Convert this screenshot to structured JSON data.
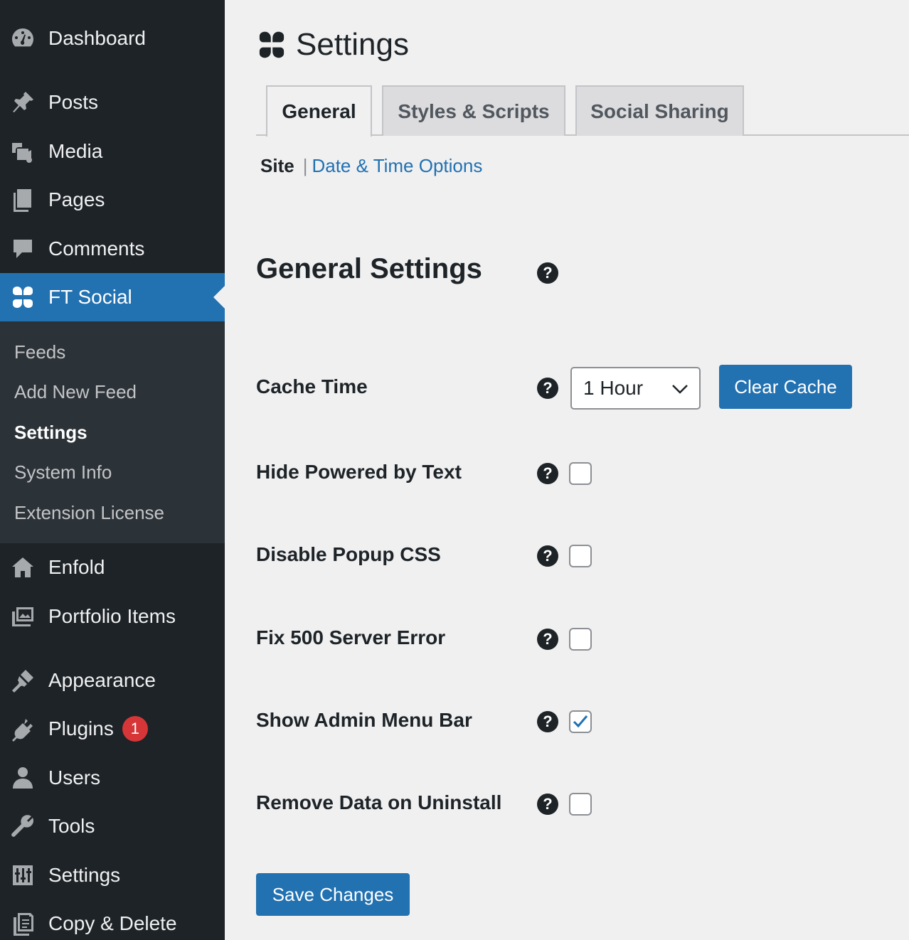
{
  "sidebar": {
    "items": [
      {
        "label": "Dashboard",
        "icon": "dashboard-icon"
      },
      {
        "label": "Posts",
        "icon": "pin-icon"
      },
      {
        "label": "Media",
        "icon": "media-icon"
      },
      {
        "label": "Pages",
        "icon": "pages-icon"
      },
      {
        "label": "Comments",
        "icon": "comment-icon"
      },
      {
        "label": "FT Social",
        "icon": "ft-social-icon"
      },
      {
        "label": "Enfold",
        "icon": "home-icon"
      },
      {
        "label": "Portfolio Items",
        "icon": "portfolio-icon"
      },
      {
        "label": "Appearance",
        "icon": "brush-icon"
      },
      {
        "label": "Plugins",
        "icon": "plugin-icon",
        "badge": "1"
      },
      {
        "label": "Users",
        "icon": "user-icon"
      },
      {
        "label": "Tools",
        "icon": "wrench-icon"
      },
      {
        "label": "Settings",
        "icon": "settings-icon"
      },
      {
        "label": "Copy & Delete",
        "icon": "copy-icon"
      }
    ],
    "submenu": [
      "Feeds",
      "Add New Feed",
      "Settings",
      "System Info",
      "Extension License"
    ],
    "active": "FT Social",
    "active_submenu": "Settings"
  },
  "main": {
    "title": "Settings",
    "tabs": [
      {
        "label": "General",
        "active": true
      },
      {
        "label": "Styles & Scripts",
        "active": false
      },
      {
        "label": "Social Sharing",
        "active": false
      }
    ],
    "subnav": {
      "current": "Site",
      "separator": "|",
      "link": "Date & Time Options"
    },
    "section_title": "General Settings",
    "help_glyph": "?",
    "cache_time": {
      "label": "Cache Time",
      "value": "1 Hour",
      "clear_button": "Clear Cache"
    },
    "options": [
      {
        "label": "Hide Powered by Text",
        "checked": false
      },
      {
        "label": "Disable Popup CSS",
        "checked": false
      },
      {
        "label": "Fix 500 Server Error",
        "checked": false
      },
      {
        "label": "Show Admin Menu Bar",
        "checked": true
      },
      {
        "label": "Remove Data on Uninstall",
        "checked": false
      }
    ],
    "save_button": "Save Changes"
  },
  "colors": {
    "sidebar_bg": "#1d2327",
    "submenu_bg": "#2c3338",
    "accent": "#2271b1",
    "badge": "#d63638",
    "page_bg": "#f0f0f1"
  }
}
